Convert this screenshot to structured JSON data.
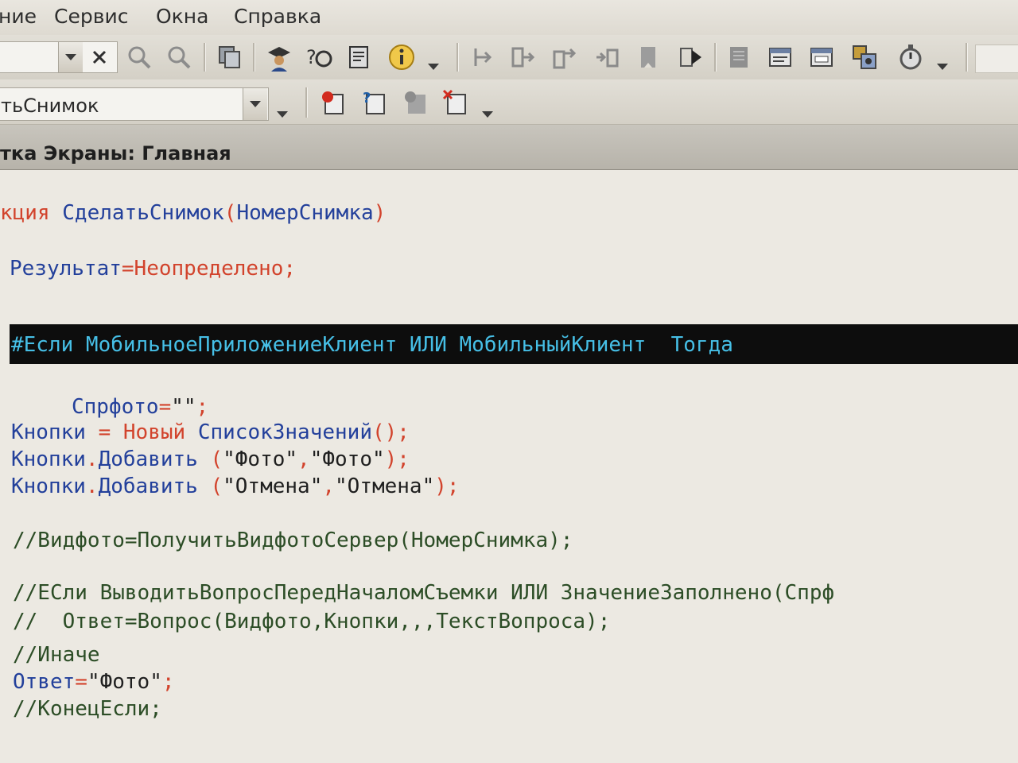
{
  "menu": [
    "ние",
    "Сервис",
    "Окна",
    "Справка"
  ],
  "toolbar": {
    "combo1_value": "",
    "combo2_value": "тьСнимок",
    "icons_row1": [
      "search-prev-icon",
      "search-next-icon",
      "copy-icon",
      "wizard-icon",
      "syntax-help-icon",
      "template-icon",
      "info-icon",
      "indent-icon",
      "step-into-icon",
      "step-out-icon",
      "step-over-icon",
      "bookmark-icon",
      "run-to-cursor-icon",
      "module-icon",
      "properties-icon",
      "form-icon",
      "calc-icon",
      "timer-icon"
    ],
    "icons_row2": [
      "breakpoint-add-icon",
      "breakpoint-list-icon",
      "breakpoint-disable-icon",
      "breakpoint-remove-icon"
    ]
  },
  "module_title": "тка Экраны: Главная",
  "code": {
    "l1_kw": "кция",
    "l1_name": "СделатьСнимок",
    "l1_paren_open": "(",
    "l1_param": "НомерСнимка",
    "l1_paren_close": ")",
    "l2_id": "Результат",
    "l2_eq": "=",
    "l2_val": "Неопределено",
    "l2_semi": ";",
    "l3_text": "#Если МобильноеПриложениеКлиент ИЛИ МобильныйКлиент  Тогда",
    "l4_id": "Спрфото",
    "l4_eq": "=",
    "l4_str": "\"\"",
    "l4_semi": ";",
    "l5_id": "Кнопки",
    "l5_eq": " = ",
    "l5_kw": "Новый",
    "l5_sp": " ",
    "l5_type": "СписокЗначений",
    "l5_end": "();",
    "l6_id": "Кнопки",
    "l6_dot": ".",
    "l6_meth": "Добавить",
    "l6_p1": " (",
    "l6_s1": "\"Фото\"",
    "l6_comma": ",",
    "l6_s2": "\"Фото\"",
    "l6_end": ");",
    "l7_id": "Кнопки",
    "l7_dot": ".",
    "l7_meth": "Добавить",
    "l7_p1": " (",
    "l7_s1": "\"Отмена\"",
    "l7_comma": ",",
    "l7_s2": "\"Отмена\"",
    "l7_end": ");",
    "l8_text": "//Видфото=ПолучитьВидфотоСервер(НомерСнимка);",
    "l9_text": "//ЕСли ВыводитьВопросПередНачаломСъемки ИЛИ ЗначениеЗаполнено(Спрф",
    "l10_text": "//  Ответ=Вопрос(Видфото,Кнопки,,,ТекстВопроса);",
    "l11_text": "//Иначе",
    "l12_id": "Ответ",
    "l12_eq": "=",
    "l12_str": "\"Фото\"",
    "l12_semi": ";",
    "l13_text": "//КонецЕсли;"
  }
}
